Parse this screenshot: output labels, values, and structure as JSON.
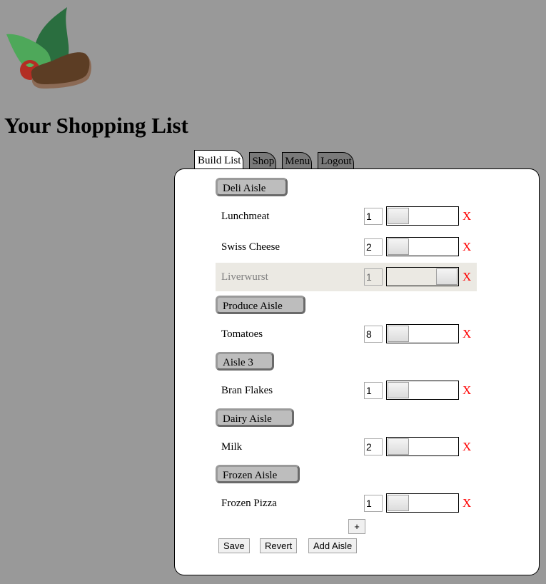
{
  "header": {
    "logo": "grocery-logo",
    "title": "Your Shopping List"
  },
  "tabs": [
    {
      "label": "Build List",
      "active": true
    },
    {
      "label": "Shop",
      "active": false
    },
    {
      "label": "Menu",
      "active": false
    },
    {
      "label": "Logout",
      "active": false
    }
  ],
  "aisles": [
    {
      "name": "Deli Aisle",
      "items": [
        {
          "name": "Lunchmeat",
          "qty": "1",
          "slider": 0,
          "disabled": false,
          "remove": "X"
        },
        {
          "name": "Swiss Cheese",
          "qty": "2",
          "slider": 0,
          "disabled": false,
          "remove": "X"
        },
        {
          "name": "Liverwurst",
          "qty": "1",
          "slider": 1,
          "disabled": true,
          "remove": "X"
        }
      ]
    },
    {
      "name": "Produce Aisle",
      "items": [
        {
          "name": "Tomatoes",
          "qty": "8",
          "slider": 0,
          "disabled": false,
          "remove": "X"
        }
      ]
    },
    {
      "name": "Aisle 3",
      "items": [
        {
          "name": "Bran Flakes",
          "qty": "1",
          "slider": 0,
          "disabled": false,
          "remove": "X"
        }
      ]
    },
    {
      "name": "Dairy Aisle",
      "items": [
        {
          "name": "Milk",
          "qty": "2",
          "slider": 0,
          "disabled": false,
          "remove": "X"
        }
      ]
    },
    {
      "name": "Frozen Aisle",
      "items": [
        {
          "name": "Frozen Pizza",
          "qty": "1",
          "slider": 0,
          "disabled": false,
          "remove": "X"
        }
      ]
    }
  ],
  "actions": {
    "add_item": "+",
    "save": "Save",
    "revert": "Revert",
    "add_aisle": "Add Aisle"
  },
  "colors": {
    "background": "#999999",
    "remove": "#ff0000",
    "aisle_button": "#bdbdbd"
  }
}
